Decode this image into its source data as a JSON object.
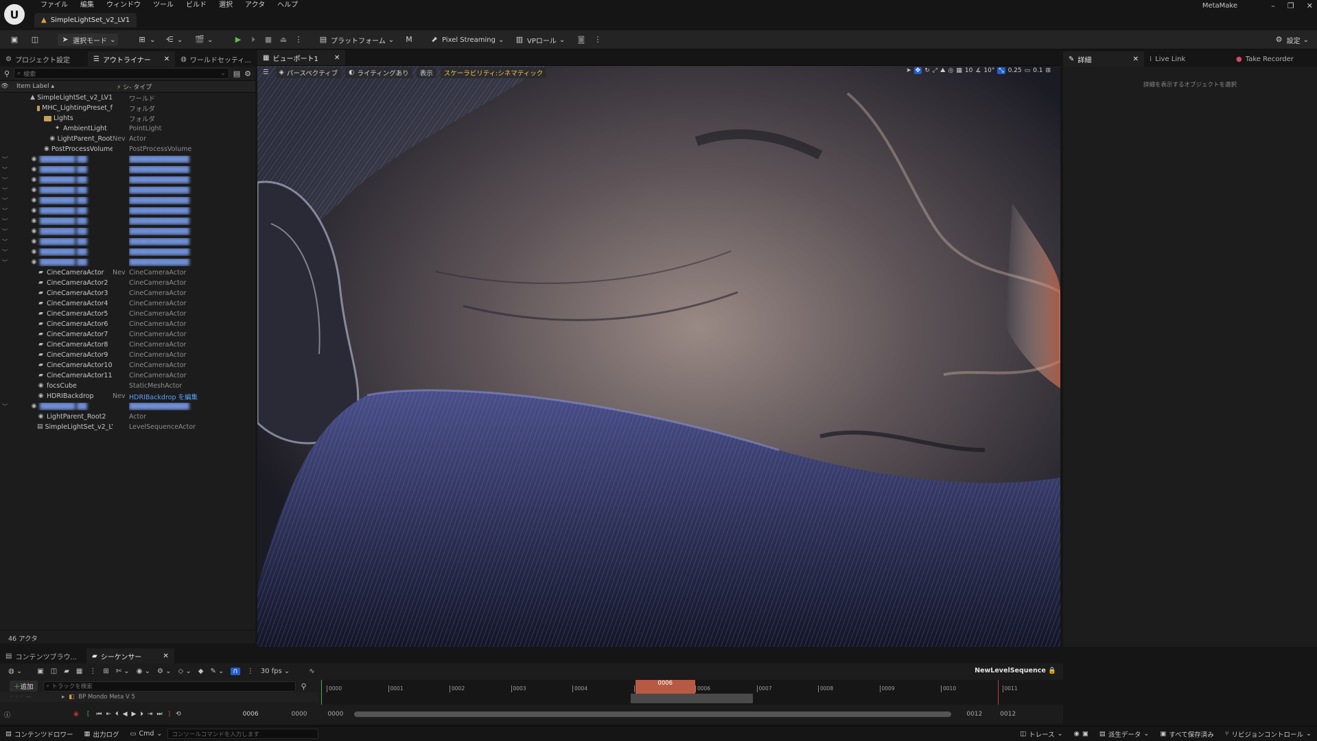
{
  "app": {
    "name": "MetaMake",
    "project_tab": "SimpleLightSet_v2_LV1"
  },
  "menu": [
    "ファイル",
    "編集",
    "ウィンドウ",
    "ツール",
    "ビルド",
    "選択",
    "アクタ",
    "ヘルプ"
  ],
  "toolbar": {
    "mode": "選択モード",
    "platform": "プラットフォーム",
    "pixel_streaming": "Pixel Streaming",
    "vp_role": "VPロール",
    "settings": "設定"
  },
  "left_tabs": [
    "プロジェクト設定",
    "アウトライナー",
    "ワールドセッティ..."
  ],
  "outliner": {
    "search_placeholder": "検索",
    "col_label": "Item Label",
    "col_type": "シ- タイプ",
    "rows": [
      {
        "label": "SimpleLightSet_v2_LV1",
        "nev": "",
        "type": "ワールド"
      },
      {
        "label": "MHC_LightingPreset_f",
        "nev": "",
        "type": "フォルダ"
      },
      {
        "label": "Lights",
        "nev": "",
        "type": "フォルダ"
      },
      {
        "label": "AmbientLight",
        "nev": "",
        "type": "PointLight"
      },
      {
        "label": "LightParent_Root",
        "nev": "Nev",
        "type": "Actor"
      },
      {
        "label": "PostProcessVolume",
        "nev": "",
        "type": "PostProcessVolume"
      },
      {
        "label": "CineCameraActor",
        "nev": "Nev",
        "type": "CineCameraActor"
      },
      {
        "label": "CineCameraActor2",
        "nev": "",
        "type": "CineCameraActor"
      },
      {
        "label": "CineCameraActor3",
        "nev": "",
        "type": "CineCameraActor"
      },
      {
        "label": "CineCameraActor4",
        "nev": "",
        "type": "CineCameraActor"
      },
      {
        "label": "CineCameraActor5",
        "nev": "",
        "type": "CineCameraActor"
      },
      {
        "label": "CineCameraActor6",
        "nev": "",
        "type": "CineCameraActor"
      },
      {
        "label": "CineCameraActor7",
        "nev": "",
        "type": "CineCameraActor"
      },
      {
        "label": "CineCameraActor8",
        "nev": "",
        "type": "CineCameraActor"
      },
      {
        "label": "CineCameraActor9",
        "nev": "",
        "type": "CineCameraActor"
      },
      {
        "label": "CineCameraActor10",
        "nev": "",
        "type": "CineCameraActor"
      },
      {
        "label": "CineCameraActor11",
        "nev": "",
        "type": "CineCameraActor"
      },
      {
        "label": "focsCube",
        "nev": "",
        "type": "StaticMeshActor"
      },
      {
        "label": "HDRIBackdrop",
        "nev": "Nev",
        "type": "HDRIBackdrop を編集"
      },
      {
        "label": "LightParent_Root2",
        "nev": "",
        "type": "Actor"
      },
      {
        "label": "SimpleLightSet_v2_LV",
        "nev": "",
        "type": "LevelSequenceActor"
      }
    ],
    "actor_count": "46 アクタ"
  },
  "viewport": {
    "tab": "ビューポート1",
    "perspective": "パースペクティブ",
    "lighting": "ライティングあり",
    "show": "表示",
    "scalability": "スケーラビリティ:シネマティック",
    "grid": "10",
    "angle": "10°",
    "scale": "0.25",
    "camera_speed": "0.1"
  },
  "right_tabs": [
    "詳細",
    "Live Link",
    "Take Recorder"
  ],
  "details_hint": "詳細を表示するオブジェクトを選択",
  "bottom_tabs": [
    "コンテンツブラウ...",
    "シーケンサー"
  ],
  "sequencer": {
    "add": "追加",
    "search_placeholder": "トラックを検索",
    "fps": "30 fps",
    "sequence_name": "NewLevelSequence",
    "track": "BP Mondo Meta V 5",
    "current_frame": "0006",
    "ticks": [
      "0000",
      "0001",
      "0002",
      "0003",
      "0004",
      "0005",
      "0006",
      "0007",
      "0008",
      "0009",
      "0010",
      "0011"
    ],
    "range_start": "0000",
    "range_start2": "0000",
    "range_end": "0012",
    "range_end2": "0012"
  },
  "status": {
    "content_drawer": "コンテンツドロワー",
    "output_log": "出力ログ",
    "cmd": "Cmd",
    "console_placeholder": "コンソールコマンドを入力します",
    "trace": "トレース",
    "derived_data": "派生データ",
    "save_all": "すべて保存済み",
    "revision_control": "リビジョンコントロール"
  }
}
